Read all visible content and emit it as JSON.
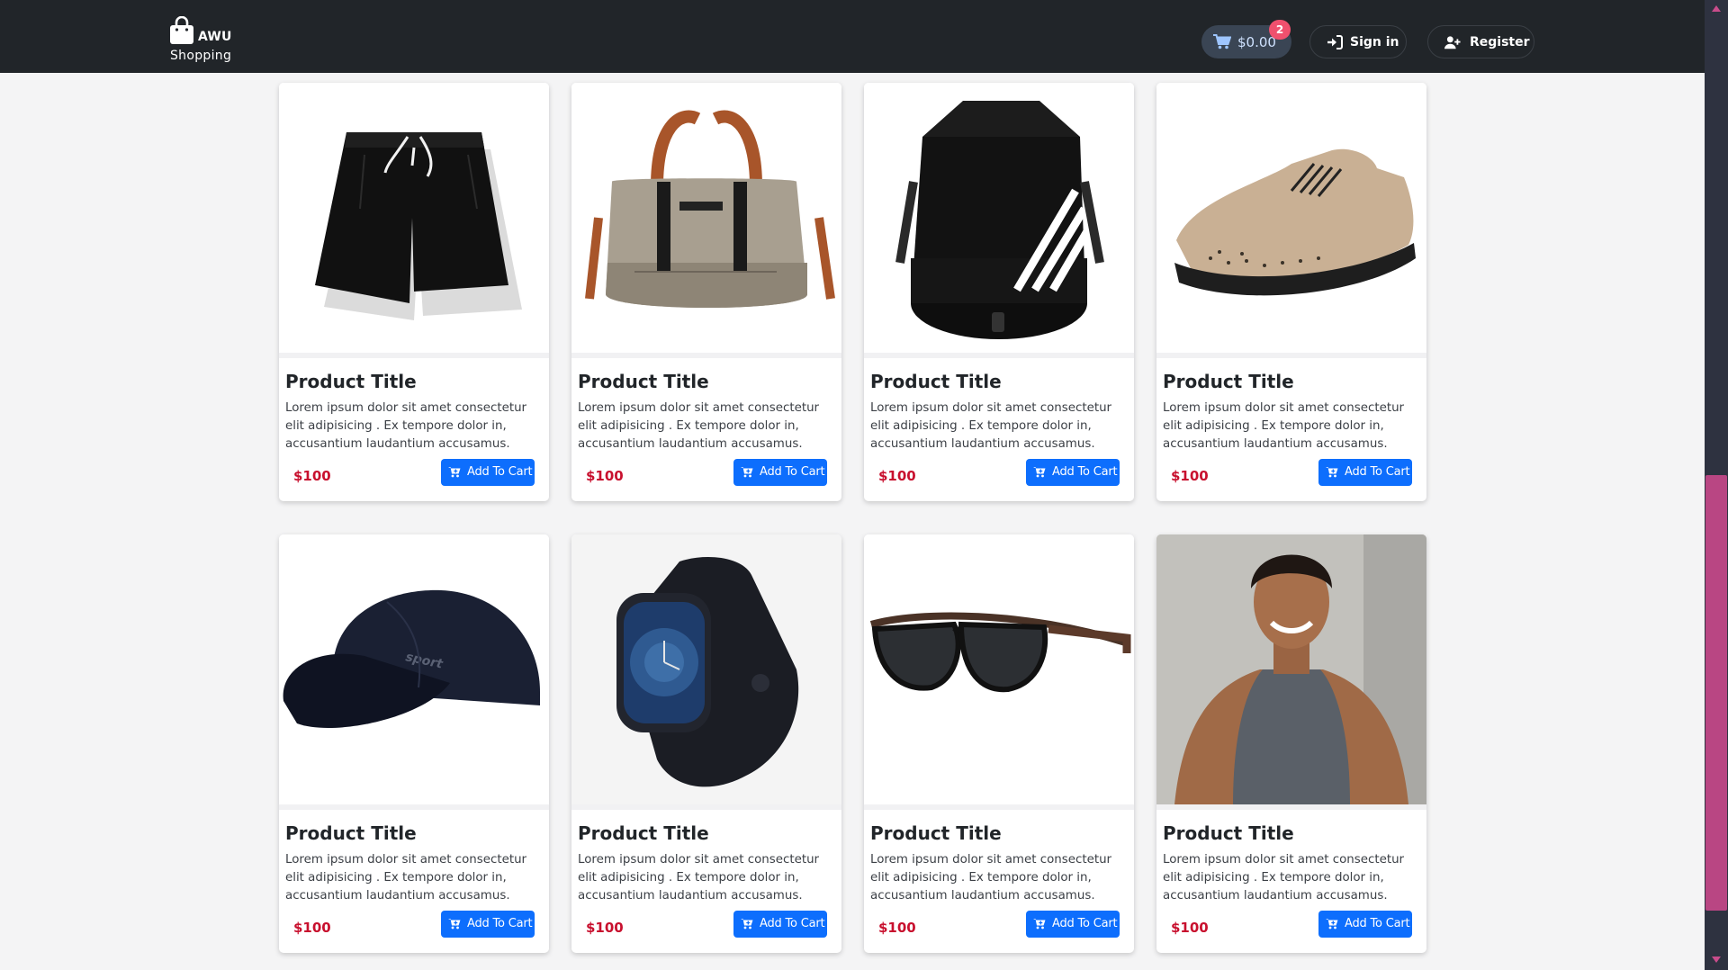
{
  "brand": {
    "name": "AWU",
    "subtitle": "Shopping"
  },
  "header": {
    "cart_total": "$0.00",
    "cart_count": "2",
    "signin_label": "Sign in",
    "register_label": "Register"
  },
  "colors": {
    "accent": "#0d6efd",
    "price": "#c8102e",
    "header_bg": "#212529",
    "badge": "#f0506e"
  },
  "products": [
    {
      "title": "Product Title",
      "description": "Lorem ipsum dolor sit amet consectetur elit adipisicing . Ex tempore dolor in, accusantium laudantium accusamus.",
      "price": "$100",
      "button": "Add To Cart",
      "image": "black-shorts"
    },
    {
      "title": "Product Title",
      "description": "Lorem ipsum dolor sit amet consectetur elit adipisicing . Ex tempore dolor in, accusantium laudantium accusamus.",
      "price": "$100",
      "button": "Add To Cart",
      "image": "duffel-bag"
    },
    {
      "title": "Product Title",
      "description": "Lorem ipsum dolor sit amet consectetur elit adipisicing . Ex tempore dolor in, accusantium laudantium accusamus.",
      "price": "$100",
      "button": "Add To Cart",
      "image": "drawstring-backpack"
    },
    {
      "title": "Product Title",
      "description": "Lorem ipsum dolor sit amet consectetur elit adipisicing . Ex tempore dolor in, accusantium laudantium accusamus.",
      "price": "$100",
      "button": "Add To Cart",
      "image": "knit-sneaker"
    },
    {
      "title": "Product Title",
      "description": "Lorem ipsum dolor sit amet consectetur elit adipisicing . Ex tempore dolor in, accusantium laudantium accusamus.",
      "price": "$100",
      "button": "Add To Cart",
      "image": "sport-cap"
    },
    {
      "title": "Product Title",
      "description": "Lorem ipsum dolor sit amet consectetur elit adipisicing . Ex tempore dolor in, accusantium laudantium accusamus.",
      "price": "$100",
      "button": "Add To Cart",
      "image": "smart-watch"
    },
    {
      "title": "Product Title",
      "description": "Lorem ipsum dolor sit amet consectetur elit adipisicing . Ex tempore dolor in, accusantium laudantium accusamus.",
      "price": "$100",
      "button": "Add To Cart",
      "image": "sunglasses"
    },
    {
      "title": "Product Title",
      "description": "Lorem ipsum dolor sit amet consectetur elit adipisicing . Ex tempore dolor in, accusantium laudantium accusamus.",
      "price": "$100",
      "button": "Add To Cart",
      "image": "man-tank-top"
    }
  ],
  "icons": {
    "brand": "shopping-bag-icon",
    "cart": "cart-icon",
    "signin": "sign-in-icon",
    "register": "user-plus-icon",
    "add_to_cart": "cart-plus-icon"
  }
}
